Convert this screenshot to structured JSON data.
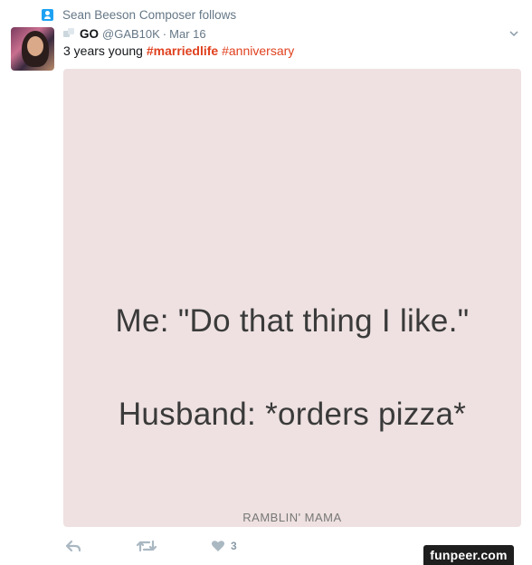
{
  "social_context": {
    "text": "Sean Beeson Composer follows",
    "icon": "follow-icon"
  },
  "tweet": {
    "display_name": "GO",
    "handle": "@GAB10K",
    "separator": "·",
    "date": "Mar 16",
    "text_plain": "3 years young ",
    "hashtag1": "#marriedlife",
    "hashtag2": "#anniversary"
  },
  "media": {
    "line1": "Me: \"Do that thing I like.\"",
    "line2": "Husband: *orders pizza*",
    "brand": "RAMBLIN' MAMA"
  },
  "actions": {
    "reply_icon": "reply-icon",
    "retweet_icon": "retweet-icon",
    "like_icon": "heart-icon",
    "like_count": "3"
  },
  "watermark": "funpeer.com",
  "colors": {
    "hashtag": "#e0411f",
    "muted": "#657786",
    "media_bg": "#efe1e1",
    "accent": "#1da1f2"
  }
}
